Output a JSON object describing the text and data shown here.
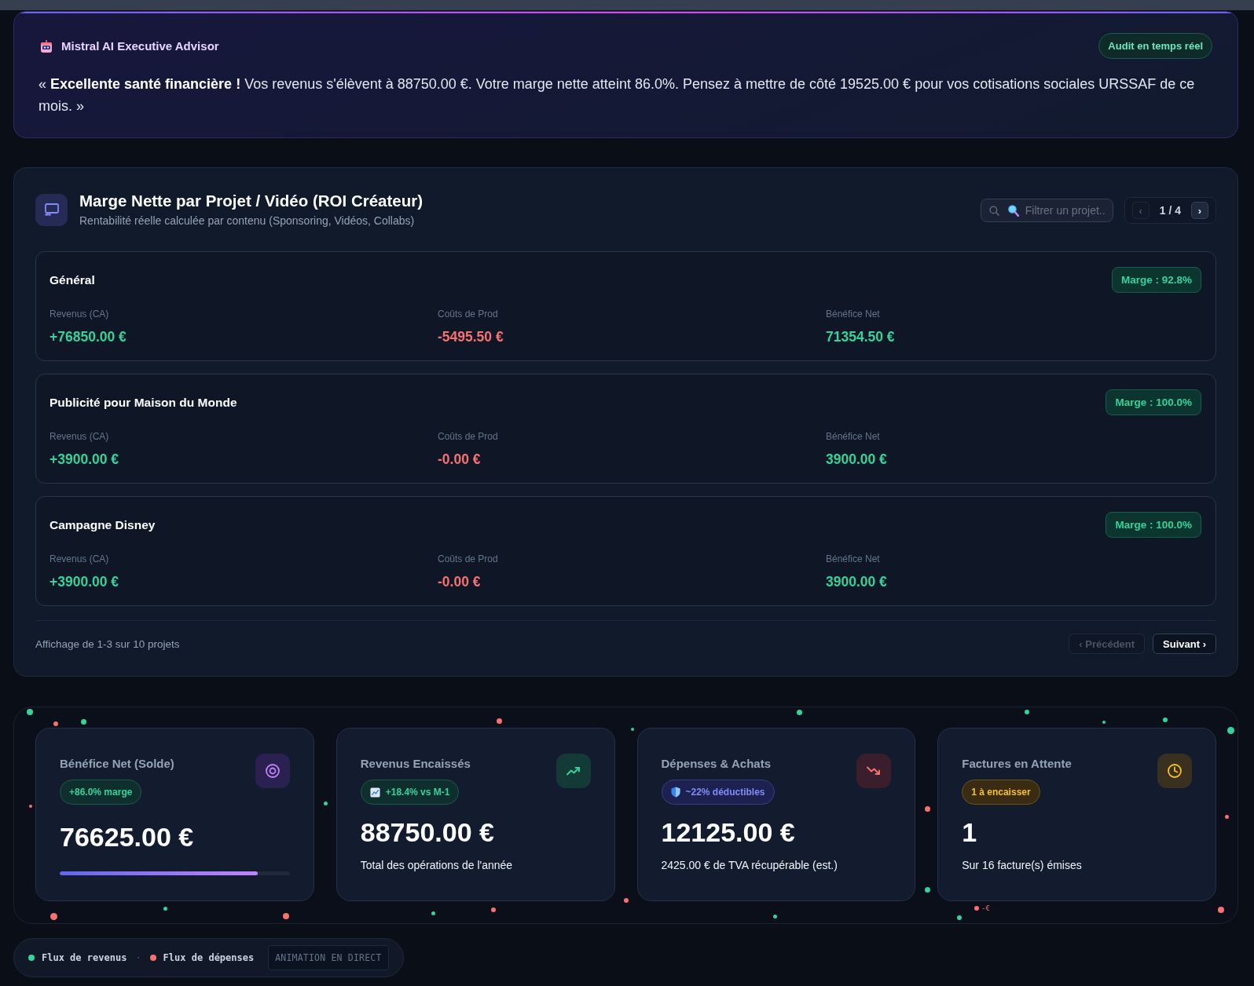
{
  "advisor": {
    "title": "Mistral AI Executive Advisor",
    "badge": "Audit en temps réel",
    "message": "« **Excellente santé financière !** Vos revenus s'élèvent à 88750.00 €. Votre marge nette atteint 86.0%. Pensez à mettre de côté 19525.00 € pour vos cotisations sociales URSSAF de ce mois. »"
  },
  "projects": {
    "title": "Marge Nette par Projet / Vidéo (ROI Créateur)",
    "subtitle": "Rentabilité réelle calculée par contenu (Sponsoring, Vidéos, Collabs)",
    "search": {
      "placeholder": "Filtrer un projet.."
    },
    "pager": {
      "buttons": [
        {
          "label": "‹",
          "disabled": true
        },
        {
          "label": "›",
          "disabled": false
        }
      ],
      "page": "1 / 4"
    },
    "rows": [
      {
        "name": "Général",
        "margin": "Marge : 92.8%",
        "metrics": [
          {
            "kind": "revenue",
            "label": "Revenus (CA)",
            "value": "+76850.00 €"
          },
          {
            "kind": "cost",
            "label": "Coûts de Prod",
            "value": "-5495.50 €"
          },
          {
            "kind": "net",
            "label": "Bénéfice Net",
            "value": "71354.50 €"
          }
        ]
      },
      {
        "name": "Publicité pour Maison du Monde",
        "margin": "Marge : 100.0%",
        "metrics": [
          {
            "kind": "revenue",
            "label": "Revenus (CA)",
            "value": "+3900.00 €"
          },
          {
            "kind": "cost",
            "label": "Coûts de Prod",
            "value": "-0.00 €"
          },
          {
            "kind": "net",
            "label": "Bénéfice Net",
            "value": "3900.00 €"
          }
        ]
      },
      {
        "name": "Campagne Disney",
        "margin": "Marge : 100.0%",
        "metrics": [
          {
            "kind": "revenue",
            "label": "Revenus (CA)",
            "value": "+3900.00 €"
          },
          {
            "kind": "cost",
            "label": "Coûts de Prod",
            "value": "-0.00 €"
          },
          {
            "kind": "net",
            "label": "Bénéfice Net",
            "value": "3900.00 €"
          }
        ]
      }
    ],
    "summary": "Affichage de 1-3 sur 10 projets",
    "nav_buttons": [
      {
        "label": "‹ Précédent",
        "disabled": true
      },
      {
        "label": "Suivant ›",
        "disabled": false
      }
    ]
  },
  "stats": {
    "cards": [
      {
        "kind": "net",
        "title": "Bénéfice Net (Solde)",
        "badge": "+86.0% marge",
        "value": "76625.00 €",
        "level": 0.86
      },
      {
        "kind": "revenue",
        "title": "Revenus Encaissés",
        "badge": "+18.4% vs M-1",
        "value": "88750.00 €",
        "note": "Total des opérations de l'année"
      },
      {
        "kind": "expense",
        "title": "Dépenses & Achats",
        "badge": "~22% déductibles",
        "value": "12125.00 €",
        "note": "2425.00 € de TVA récupérable (est.)"
      },
      {
        "kind": "pending",
        "title": "Factures en Attente",
        "badge": "1 à encaisser",
        "value": "1",
        "note": "Sur 16 facture(s) émises"
      }
    ],
    "particles": [
      {
        "color": "#34d399"
      },
      {
        "color": "#34d399"
      },
      {
        "color": "#f87171"
      },
      {
        "color": "#f87171"
      },
      {
        "color": "#34d399"
      },
      {
        "color": "#34d399"
      },
      {
        "color": "#34d399"
      },
      {
        "color": "#34d399"
      },
      {
        "color": "#34d399"
      },
      {
        "color": "#34d399"
      },
      {
        "color": "#f87171"
      },
      {
        "color": "#34d399"
      },
      {
        "color": "#f87171"
      },
      {
        "color": "#f87171"
      },
      {
        "color": "#f87171"
      },
      {
        "color": "#f87171"
      },
      {
        "color": "#f87171"
      },
      {
        "color": "#34d399"
      },
      {
        "color": "#f87171"
      },
      {
        "color": "#34d399"
      },
      {
        "color": "#34d399"
      },
      {
        "color": "#f87171",
        "label": "-€"
      },
      {
        "color": "#34d399"
      },
      {
        "color": "#f87171"
      },
      {
        "color": "#34d399"
      }
    ]
  },
  "legend": {
    "items": [
      {
        "label": "Flux de revenus",
        "color": "#34d399"
      },
      {
        "label": "Flux de dépenses",
        "color": "#f87171"
      }
    ],
    "separator": "·",
    "tag": "ANIMATION EN DIRECT"
  }
}
